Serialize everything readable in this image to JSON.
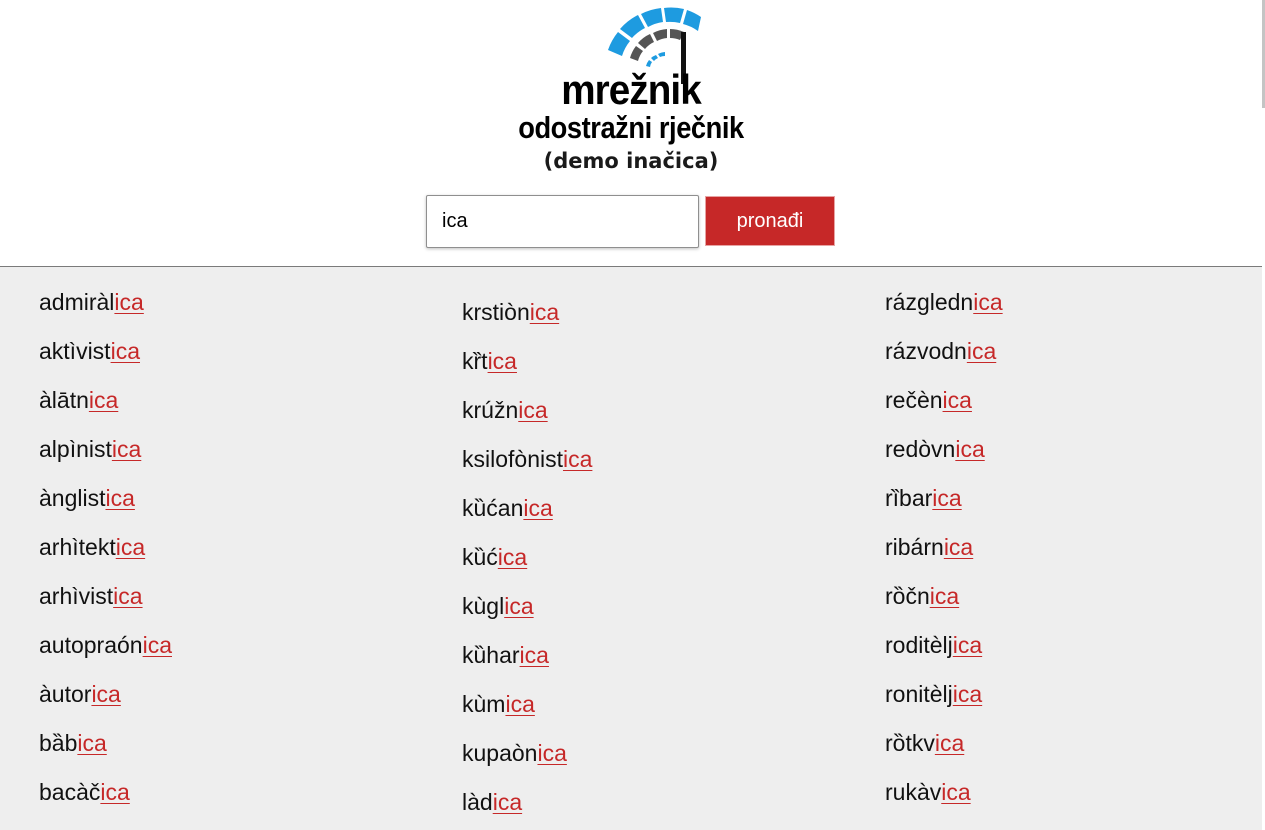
{
  "header": {
    "brand_name": "mrežnik",
    "tagline": "odostražni rječnik",
    "subtitle": "(demo inačica)",
    "logo_icon": "mreznik-logo-icon",
    "accent_color": "#c62828",
    "logo_blue": "#1e9be0",
    "logo_gray": "#555555"
  },
  "search": {
    "value": "ica",
    "button_label": "pronađi"
  },
  "results": {
    "suffix": "ica",
    "columns": [
      [
        "admiràl",
        "aktìvist",
        "àlātn",
        "alpìnist",
        "ànglist",
        "arhìtekt",
        "arhìvist",
        "autopraón",
        "àutor",
        "bȁb",
        "bacàč"
      ],
      [
        "krstiòn",
        "kȑt",
        "krúžn",
        "ksilofònist",
        "kȕćan",
        "kȕć",
        "kùgl",
        "kȕhar",
        "kùm",
        "kupaòn",
        "làd"
      ],
      [
        "rázgledn",
        "rázvodn",
        "rečèn",
        "redòvn",
        "rȉbar",
        "ribárn",
        "rȍčn",
        "roditèlj",
        "ronitèlj",
        "rȍtkv",
        "rukàv"
      ]
    ]
  }
}
